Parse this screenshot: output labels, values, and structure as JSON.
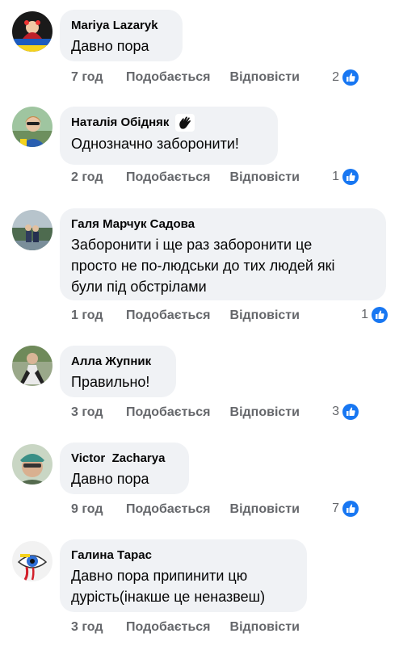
{
  "comments": [
    {
      "author": "Mariya Lazaryk",
      "text": "Давно пора",
      "time": "7 год",
      "like_label": "Подобається",
      "reply_label": "Відповісти",
      "reactions": "2",
      "badge": false
    },
    {
      "author": "Наталія Обідняк",
      "text": "Однозначно заборонити!",
      "time": "2 год",
      "like_label": "Подобається",
      "reply_label": "Відповісти",
      "reactions": "1",
      "badge": true
    },
    {
      "author": "Галя Марчук Садова",
      "text": "Заборонити і ще раз заборонити це\nпросто не по-людськи до тих людей які\nбули під обстрілами",
      "time": "1 год",
      "like_label": "Подобається",
      "reply_label": "Відповісти",
      "reactions": "1",
      "badge": false
    },
    {
      "author": "Алла Жупник",
      "text": "Правильно!",
      "time": "3 год",
      "like_label": "Подобається",
      "reply_label": "Відповісти",
      "reactions": "3",
      "badge": false
    },
    {
      "author": "Victor  Zacharya",
      "text": "Давно пора",
      "time": "9 год",
      "like_label": "Подобається",
      "reply_label": "Відповісти",
      "reactions": "7",
      "badge": false
    },
    {
      "author": "Галина Тарас",
      "text": "Давно пора припинити цю\nдурість(інакше це неназвеш)",
      "time": "3 год",
      "like_label": "Подобається",
      "reply_label": "Відповісти",
      "reactions": "",
      "badge": false
    }
  ],
  "icons": {
    "reaction": "like-thumb-icon",
    "badge": "waving-hand-icon"
  },
  "colors": {
    "like_blue": "#1877f2",
    "bubble_bg": "#f0f2f5",
    "meta_gray": "#65676b"
  }
}
